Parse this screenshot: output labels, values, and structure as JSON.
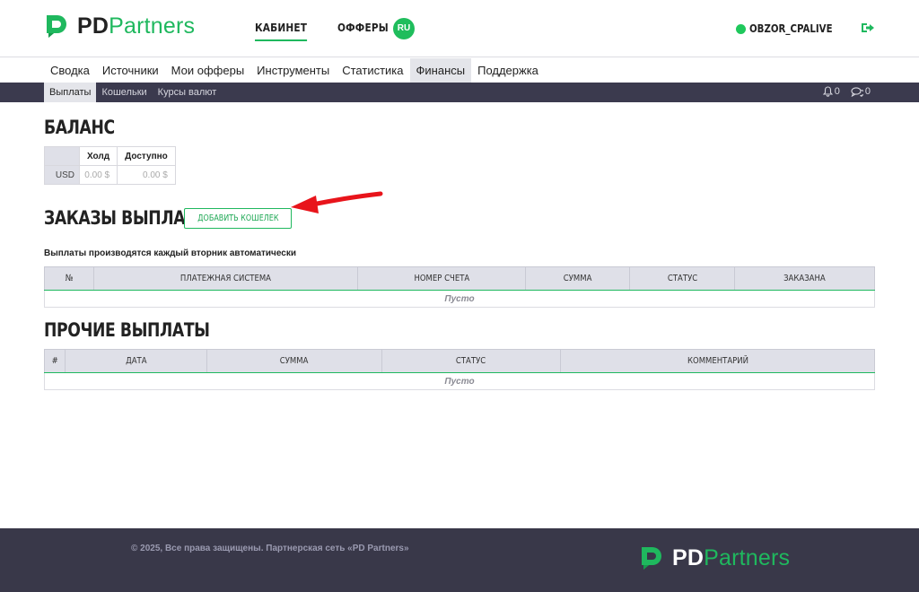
{
  "brand": {
    "pd": "PD",
    "partners": "Partners"
  },
  "topnav": {
    "cabinet": "КАБИНЕТ",
    "offers": "ОФФЕРЫ",
    "lang": "RU"
  },
  "user": {
    "name": "OBZOR_CPALIVE"
  },
  "mainnav": {
    "items": [
      "Сводка",
      "Источники",
      "Мои офферы",
      "Инструменты",
      "Статистика",
      "Финансы",
      "Поддержка"
    ],
    "active": "Финансы"
  },
  "subnav": {
    "items": [
      "Выплаты",
      "Кошельки",
      "Курсы валют"
    ],
    "active": "Выплаты",
    "notifications": "0",
    "messages": "0"
  },
  "balance": {
    "title": "БАЛАНС",
    "headers": {
      "hold": "Холд",
      "available": "Доступно"
    },
    "rows": [
      {
        "currency": "USD",
        "hold": "0.00 $",
        "available": "0.00 $"
      }
    ]
  },
  "orders": {
    "title": "ЗАКАЗЫ ВЫПЛАТ",
    "add_wallet": "ДОБАВИТЬ КОШЕЛЕК",
    "note": "Выплаты производятся каждый вторник автоматически",
    "columns": [
      "№",
      "ПЛАТЕЖНАЯ СИСТЕМА",
      "НОМЕР СЧЕТА",
      "СУММА",
      "СТАТУС",
      "ЗАКАЗАНА"
    ],
    "empty": "Пусто"
  },
  "other": {
    "title": "ПРОЧИЕ ВЫПЛАТЫ",
    "columns": [
      "#",
      "ДАТА",
      "СУММА",
      "СТАТУС",
      "КОММЕНТАРИЙ"
    ],
    "empty": "Пусто"
  },
  "footer": {
    "copyright": "© 2025, Все права защищены. Партнерская сеть «PD Partners»"
  },
  "colors": {
    "accent": "#1fb85e",
    "dark": "#3b3a4e",
    "arrow": "#e8141b"
  },
  "icons": {
    "notifications": "bell-icon",
    "messages": "chat-icon",
    "logout": "logout-icon"
  }
}
